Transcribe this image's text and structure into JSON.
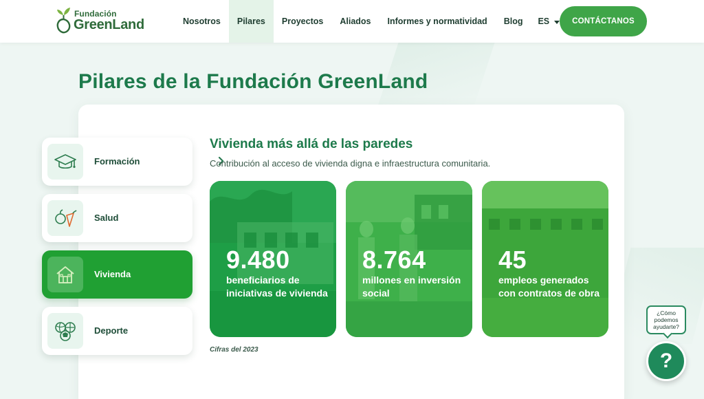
{
  "colors": {
    "brand_green": "#3fa548",
    "title_green": "#1d7a4b",
    "active_tab": "#20a033",
    "help_green": "#1f8a5b"
  },
  "header": {
    "logo": {
      "line1": "Fundación",
      "line2": "GreenLand"
    },
    "nav": [
      {
        "label": "Nosotros",
        "active": false
      },
      {
        "label": "Pilares",
        "active": true
      },
      {
        "label": "Proyectos",
        "active": false
      },
      {
        "label": "Aliados",
        "active": false
      },
      {
        "label": "Informes y normatividad",
        "active": false
      },
      {
        "label": "Blog",
        "active": false
      }
    ],
    "language": "ES",
    "cta_label": "CONTÁCTANOS"
  },
  "page_title": "Pilares de la Fundación GreenLand",
  "pillars": [
    {
      "label": "Formación",
      "icon": "graduation-cap-icon",
      "active": false
    },
    {
      "label": "Salud",
      "icon": "fruit-vegetable-icon",
      "active": false
    },
    {
      "label": "Vivienda",
      "icon": "house-icon",
      "active": true
    },
    {
      "label": "Deporte",
      "icon": "sports-balls-icon",
      "active": false
    }
  ],
  "content": {
    "title": "Vivienda más allá de las paredes",
    "subtitle": "Contribución al acceso de vivienda digna e infraestructura comunitaria.",
    "stats": [
      {
        "number": "9.480",
        "description": "beneficiarios de iniciativas de vivienda"
      },
      {
        "number": "8.764",
        "description": "millones en inversión social"
      },
      {
        "number": "45",
        "description": "empleos generados con contratos de obra"
      }
    ],
    "footnote": "Cifras del 2023"
  },
  "help": {
    "bubble_text": "¿Cómo podemos ayudarte?",
    "button_glyph": "?"
  }
}
